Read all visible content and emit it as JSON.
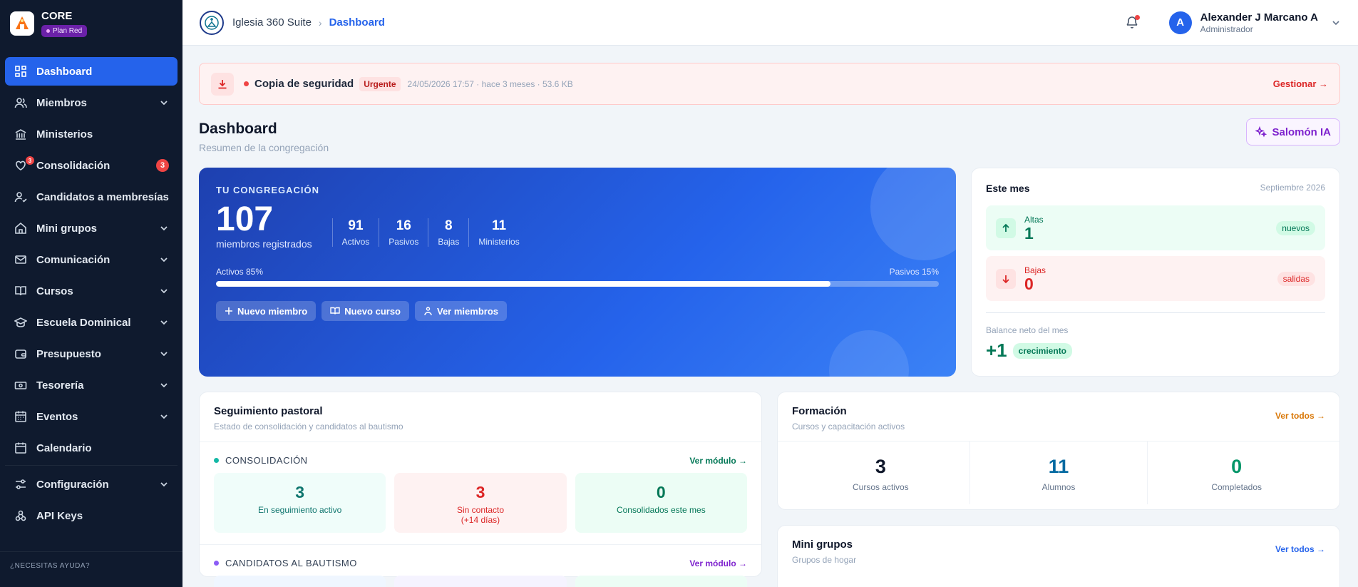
{
  "sidebar": {
    "brand": "CORE",
    "plan": "Plan Red",
    "items": [
      {
        "label": "Dashboard",
        "active": true,
        "chevron": false
      },
      {
        "label": "Miembros",
        "chevron": true
      },
      {
        "label": "Ministerios",
        "chevron": false
      },
      {
        "label": "Consolidación",
        "chevron": false,
        "badge": "3",
        "icon_badge": "3"
      },
      {
        "label": "Candidatos a membresías",
        "chevron": false
      },
      {
        "label": "Mini grupos",
        "chevron": true
      },
      {
        "label": "Comunicación",
        "chevron": true
      },
      {
        "label": "Cursos",
        "chevron": true
      },
      {
        "label": "Escuela Dominical",
        "chevron": true
      },
      {
        "label": "Presupuesto",
        "chevron": true
      },
      {
        "label": "Tesorería",
        "chevron": true
      },
      {
        "label": "Eventos",
        "chevron": true
      },
      {
        "label": "Calendario",
        "chevron": false
      },
      {
        "label": "Configuración",
        "chevron": true
      },
      {
        "label": "API Keys",
        "chevron": false
      }
    ],
    "help": "¿NECESITAS AYUDA?"
  },
  "header": {
    "breadcrumb_root": "Iglesia 360 Suite",
    "breadcrumb_current": "Dashboard",
    "user_initial": "A",
    "user_name": "Alexander J Marcano A",
    "user_role": "Administrador"
  },
  "alert": {
    "title": "Copia de seguridad",
    "tag": "Urgente",
    "meta": "24/05/2026 17:57 · hace 3 meses · 53.6 KB",
    "link": "Gestionar →"
  },
  "page": {
    "title": "Dashboard",
    "subtitle": "Resumen de la congregación",
    "ai_button": "Salomón IA"
  },
  "hero": {
    "label": "TU CONGREGACIÓN",
    "total": "107",
    "total_label": "miembros registrados",
    "stats": [
      {
        "value": "91",
        "label": "Activos"
      },
      {
        "value": "16",
        "label": "Pasivos"
      },
      {
        "value": "8",
        "label": "Bajas"
      },
      {
        "value": "11",
        "label": "Ministerios"
      }
    ],
    "active_label": "Activos 85%",
    "passive_label": "Pasivos 15%",
    "active_percent": 85,
    "actions": [
      "Nuevo miembro",
      "Nuevo curso",
      "Ver miembros"
    ]
  },
  "month": {
    "title": "Este mes",
    "date": "Septiembre 2026",
    "altas_label": "Altas",
    "altas_value": "1",
    "altas_pill": "nuevos",
    "bajas_label": "Bajas",
    "bajas_value": "0",
    "bajas_pill": "salidas",
    "balance_label": "Balance neto del mes",
    "balance_value": "+1",
    "balance_pill": "crecimiento"
  },
  "pastoral": {
    "title": "Seguimiento pastoral",
    "subtitle": "Estado de consolidación y candidatos al bautismo",
    "consolidacion_label": "CONSOLIDACIÓN",
    "consolidacion_link": "Ver módulo →",
    "tiles": [
      {
        "value": "3",
        "label": "En seguimiento activo"
      },
      {
        "value": "3",
        "label": "Sin contacto",
        "label2": "(+14 días)"
      },
      {
        "value": "0",
        "label": "Consolidados este mes"
      }
    ],
    "bautismo_label": "CANDIDATOS AL BAUTISMO",
    "bautismo_link": "Ver módulo →"
  },
  "formacion": {
    "title": "Formación",
    "subtitle": "Cursos y capacitación activos",
    "link": "Ver todos →",
    "stats": [
      {
        "value": "3",
        "label": "Cursos activos"
      },
      {
        "value": "11",
        "label": "Alumnos"
      },
      {
        "value": "0",
        "label": "Completados"
      }
    ]
  },
  "minigrupos": {
    "title": "Mini grupos",
    "subtitle": "Grupos de hogar",
    "link": "Ver todos →"
  },
  "colors": {
    "accent": "#2563eb",
    "sidebar_bg": "#0f1a2e",
    "danger": "#dc2626",
    "success": "#047857",
    "purple": "#7e22ce",
    "amber": "#d97706"
  }
}
